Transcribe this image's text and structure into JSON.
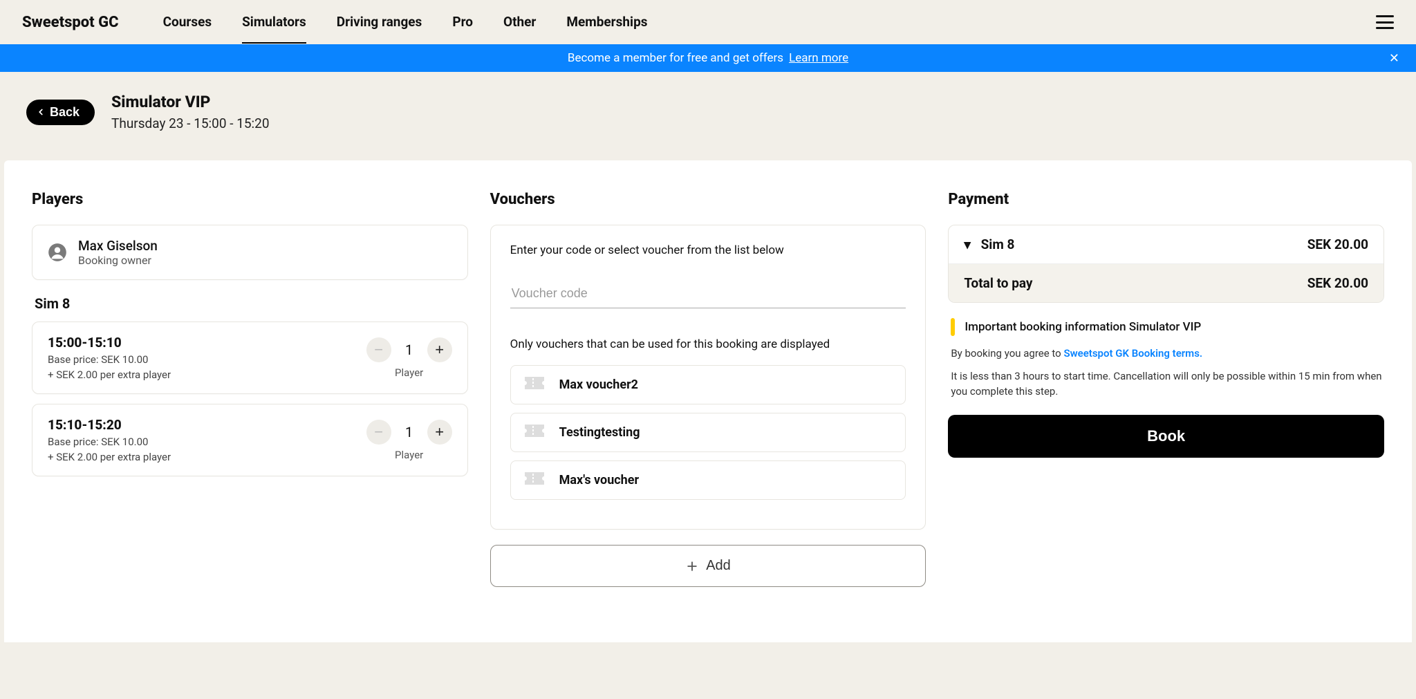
{
  "brand": "Sweetspot GC",
  "nav": {
    "items": [
      {
        "label": "Courses",
        "active": false
      },
      {
        "label": "Simulators",
        "active": true
      },
      {
        "label": "Driving ranges",
        "active": false
      },
      {
        "label": "Pro",
        "active": false
      },
      {
        "label": "Other",
        "active": false
      },
      {
        "label": "Memberships",
        "active": false
      }
    ]
  },
  "banner": {
    "text": "Become a member for free and get offers",
    "link": "Learn more"
  },
  "header": {
    "back": "Back",
    "title": "Simulator VIP",
    "subtitle": "Thursday 23 - 15:00 - 15:20"
  },
  "players": {
    "title": "Players",
    "owner": {
      "name": "Max Giselson",
      "role": "Booking owner"
    },
    "group_label": "Sim 8",
    "slots": [
      {
        "time": "15:00-15:10",
        "base": "Base price: SEK 10.00",
        "extra": "+ SEK 2.00 per extra player",
        "count": "1",
        "unit": "Player"
      },
      {
        "time": "15:10-15:20",
        "base": "Base price: SEK 10.00",
        "extra": "+ SEK 2.00 per extra player",
        "count": "1",
        "unit": "Player"
      }
    ]
  },
  "vouchers": {
    "title": "Vouchers",
    "hint": "Enter your code or select voucher from the list below",
    "placeholder": "Voucher code",
    "note": "Only vouchers that can be used for this booking are displayed",
    "items": [
      {
        "name": "Max voucher2"
      },
      {
        "name": "Testingtesting"
      },
      {
        "name": "Max's voucher"
      }
    ],
    "add_label": "Add"
  },
  "payment": {
    "title": "Payment",
    "line_label": "Sim 8",
    "line_amount": "SEK 20.00",
    "total_label": "Total to pay",
    "total_amount": "SEK 20.00",
    "info": "Important booking information Simulator VIP",
    "terms_prefix": "By booking you agree to ",
    "terms_link": "Sweetspot GK Booking terms.",
    "cancel_note": "It is less than 3 hours to start time. Cancellation will only be possible within 15 min from when you complete this step.",
    "book_label": "Book"
  }
}
